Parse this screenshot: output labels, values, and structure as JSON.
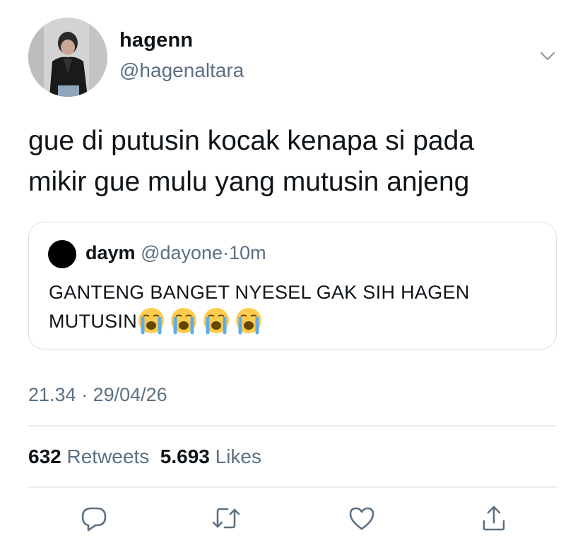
{
  "author": {
    "display_name": "hagenn",
    "handle": "@hagenaltara"
  },
  "tweet": {
    "text": "gue di putusin kocak kenapa si pada\nmikir gue mulu yang mutusin anjeng",
    "timestamp": "21.34 · 29/04/26"
  },
  "quoted_tweet": {
    "display_name": "daym",
    "handle": "@dayone",
    "separator": "·",
    "time": "10m",
    "text": "GANTENG BANGET NYESEL GAK SIH HAGEN\nMUTUSIN",
    "emoji": [
      "loudly-crying-face",
      "loudly-crying-face",
      "loudly-crying-face",
      "loudly-crying-face"
    ]
  },
  "stats": {
    "retweets_count": "632",
    "retweets_label": "Retweets",
    "likes_count": "5.693",
    "likes_label": "Likes"
  },
  "actions": {
    "icons": [
      "reply-icon",
      "retweet-icon",
      "like-icon",
      "share-icon"
    ],
    "color": "#5b7083"
  },
  "colors": {
    "text_primary": "#0f1419",
    "text_secondary": "#5b7083",
    "border": "#d8dee3"
  }
}
